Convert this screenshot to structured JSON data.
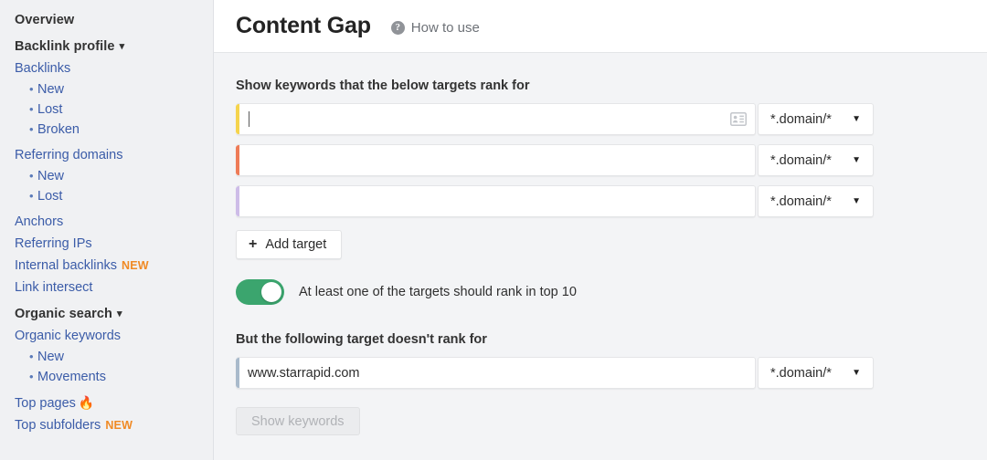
{
  "sidebar": {
    "overview_label": "Overview",
    "groups": [
      {
        "title": "Backlink profile",
        "items": [
          {
            "label": "Backlinks",
            "type": "link"
          },
          {
            "label": "New",
            "type": "sub"
          },
          {
            "label": "Lost",
            "type": "sub"
          },
          {
            "label": "Broken",
            "type": "sub"
          },
          {
            "label": "Referring domains",
            "type": "link",
            "spaced": true
          },
          {
            "label": "New",
            "type": "sub"
          },
          {
            "label": "Lost",
            "type": "sub"
          },
          {
            "label": "Anchors",
            "type": "link",
            "spaced": true
          },
          {
            "label": "Referring IPs",
            "type": "link"
          },
          {
            "label": "Internal backlinks",
            "type": "link",
            "badge": "NEW"
          },
          {
            "label": "Link intersect",
            "type": "link"
          }
        ]
      },
      {
        "title": "Organic search",
        "items": [
          {
            "label": "Organic keywords",
            "type": "link"
          },
          {
            "label": "New",
            "type": "sub"
          },
          {
            "label": "Movements",
            "type": "sub"
          },
          {
            "label": "Top pages",
            "type": "link",
            "spaced": true,
            "emoji": "🔥"
          },
          {
            "label": "Top subfolders",
            "type": "link",
            "badge": "NEW"
          }
        ]
      }
    ]
  },
  "header": {
    "title": "Content Gap",
    "help_icon": "question-mark-icon",
    "help_label": "How to use"
  },
  "form": {
    "include_label": "Show keywords that the below targets rank for",
    "targets": [
      {
        "value": "",
        "placeholder": "",
        "mode": "*.domain/*",
        "color": "#f5d44d",
        "has_card_icon": true,
        "focused": true
      },
      {
        "value": "",
        "placeholder": "",
        "mode": "*.domain/*",
        "color": "#ee7b57",
        "has_card_icon": false,
        "focused": false
      },
      {
        "value": "",
        "placeholder": "",
        "mode": "*.domain/*",
        "color": "#cdbce8",
        "has_card_icon": false,
        "focused": false
      }
    ],
    "add_target_label": "Add target",
    "add_target_icon": "plus-icon",
    "toggle": {
      "state": "on",
      "label": "At least one of the targets should rank in top 10",
      "color": "#3ba56e"
    },
    "exclude_label": "But the following target doesn't rank for",
    "exclude_target": {
      "value": "www.starrapid.com",
      "mode": "*.domain/*",
      "color": "#a9bacb"
    },
    "submit_label": "Show keywords",
    "submit_disabled": true,
    "dropdown_icon": "chevron-down-icon"
  }
}
